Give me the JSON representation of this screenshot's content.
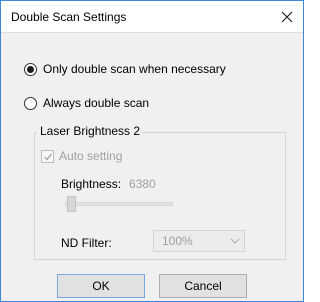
{
  "window": {
    "title": "Double Scan Settings"
  },
  "scan_mode": {
    "options": [
      {
        "label": "Only double scan when necessary",
        "checked": true
      },
      {
        "label": "Always double scan",
        "checked": false
      }
    ]
  },
  "laser_group": {
    "title": "Laser Brightness 2",
    "auto_setting_label": "Auto setting",
    "auto_setting_checked": true,
    "brightness_label": "Brightness:",
    "brightness_value": "6380",
    "nd_filter_label": "ND Filter:",
    "nd_filter_value": "100%"
  },
  "buttons": {
    "ok": "OK",
    "cancel": "Cancel"
  },
  "colors": {
    "accent": "#3c88d8",
    "disabled_text": "#a0a0a0",
    "dialog_bg": "#f0f0f0"
  },
  "icons": {
    "close": "close-icon",
    "dropdown": "chevron-down-icon",
    "check": "check-icon"
  }
}
